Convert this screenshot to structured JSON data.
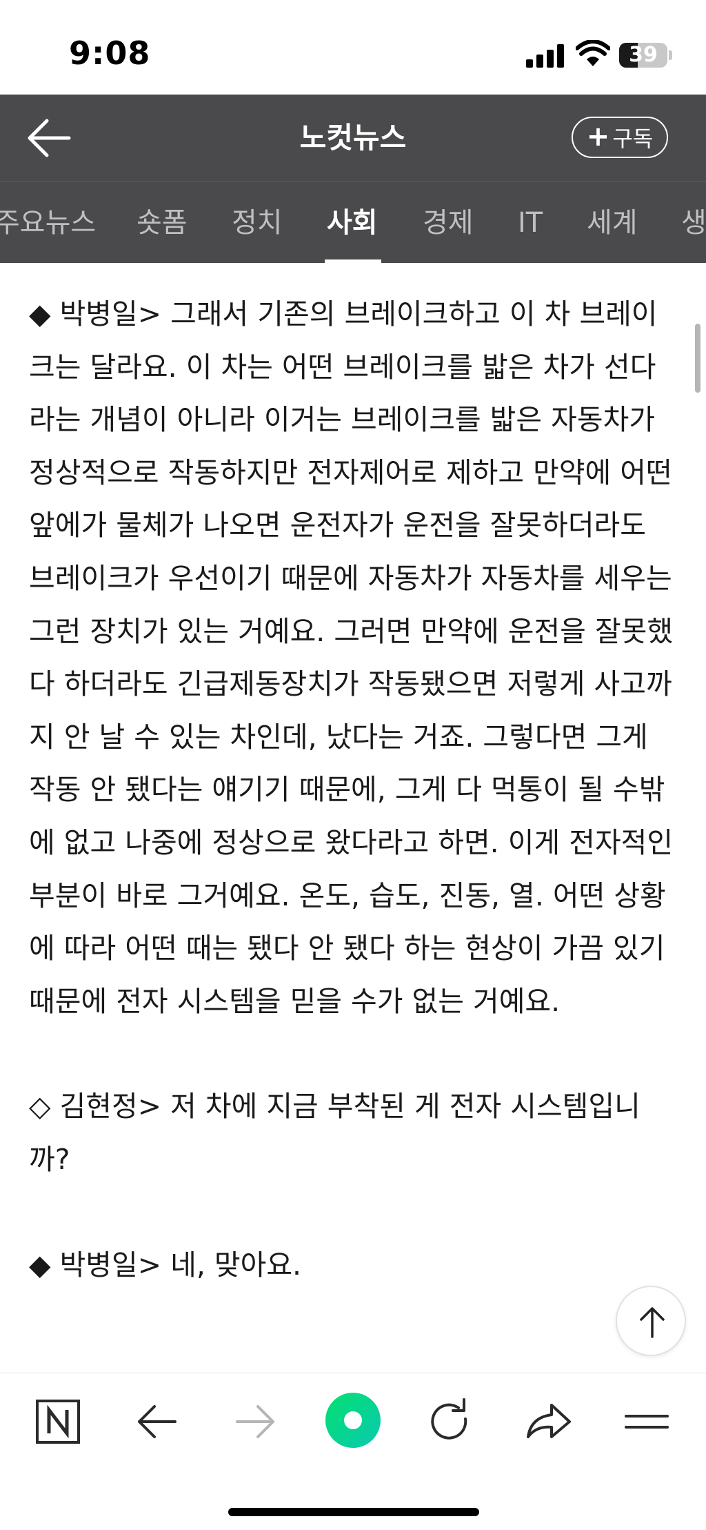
{
  "status_bar": {
    "time": "9:08",
    "battery_level": "39",
    "battery_fraction": 0.39
  },
  "header": {
    "title": "노컷뉴스",
    "subscribe_label": "구독"
  },
  "tabs": [
    {
      "label": "주요뉴스",
      "active": false
    },
    {
      "label": "숏폼",
      "active": false
    },
    {
      "label": "정치",
      "active": false
    },
    {
      "label": "사회",
      "active": true
    },
    {
      "label": "경제",
      "active": false
    },
    {
      "label": "IT",
      "active": false
    },
    {
      "label": "세계",
      "active": false
    },
    {
      "label": "생",
      "active": false
    }
  ],
  "article": {
    "paragraphs": [
      "◆ 박병일> 그래서 기존의 브레이크하고 이 차 브레이크는 달라요. 이 차는 어떤 브레이크를 밟은 차가 선다라는 개념이 아니라 이거는 브레이크를 밟은 자동차가 정상적으로 작동하지만 전자제어로 제하고 만약에 어떤 앞에가 물체가 나오면 운전자가 운전을 잘못하더라도 브레이크가 우선이기 때문에 자동차가 자동차를 세우는 그런 장치가 있는 거예요. 그러면 만약에 운전을 잘못했다 하더라도 긴급제동장치가 작동됐으면 저렇게 사고까지 안 날 수 있는 차인데, 났다는 거죠. 그렇다면 그게 작동 안 됐다는 얘기기 때문에, 그게 다 먹통이 될 수밖에 없고 나중에 정상으로 왔다라고 하면. 이게 전자적인 부분이 바로 그거예요. 온도, 습도, 진동, 열. 어떤 상황에 따라 어떤 때는 됐다 안 됐다 하는 현상이 가끔 있기 때문에 전자 시스템을 믿을 수가 없는 거예요.",
      "◇ 김현정> 저 차에 지금 부착된 게 전자 시스템입니까?",
      "◆ 박병일> 네, 맞아요."
    ]
  },
  "icons": {
    "back": "back-arrow-icon",
    "scroll_top": "arrow-up-icon",
    "toolbar": [
      "naver-home-icon",
      "back-icon",
      "forward-icon",
      "green-dot-icon",
      "refresh-icon",
      "share-icon",
      "menu-icon"
    ]
  },
  "colors": {
    "header_bg": "#4a4a4c",
    "accent_green": "#03d96c",
    "tab_inactive": "#bfbfbf"
  }
}
